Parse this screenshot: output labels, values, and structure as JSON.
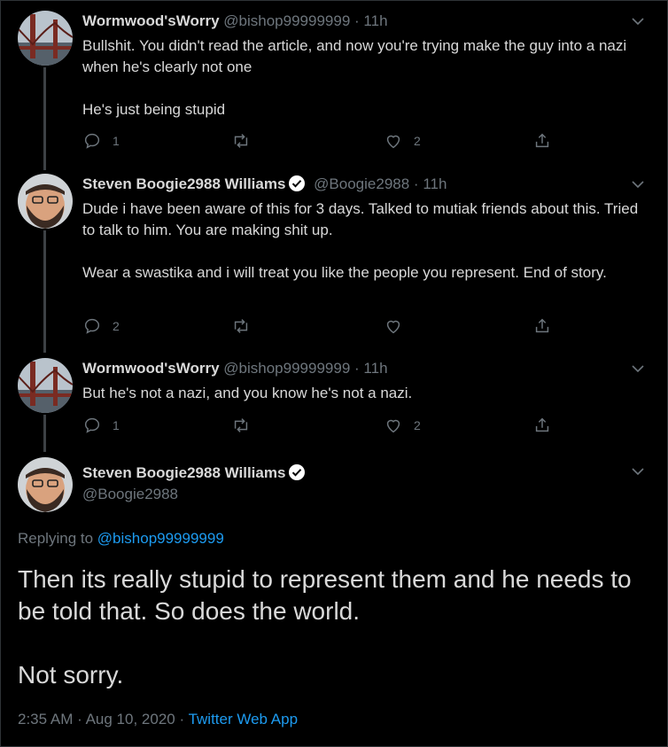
{
  "thread": [
    {
      "name": "Wormwood'sWorry",
      "handle": "@bishop99999999",
      "time": "11h",
      "text": "Bullshit.  You didn't read the article, and now you're trying make the guy into a nazi when he's clearly not one\n\nHe's just being stupid",
      "reply_count": "1",
      "retweet_count": "",
      "like_count": "2",
      "avatar": "golden-gate-bridge",
      "verified": false
    },
    {
      "name": "Steven Boogie2988 Williams",
      "handle": "@Boogie2988",
      "time": "11h",
      "text": "Dude i have been aware of this for 3 days.  Talked to mutiak friends about this. Tried to talk to him.  You are making shit up.\n\nWear a swastika and i will treat you like the people you represent.  End of story.",
      "reply_count": "2",
      "retweet_count": "",
      "like_count": "",
      "avatar": "bearded-man",
      "verified": true
    },
    {
      "name": "Wormwood'sWorry",
      "handle": "@bishop99999999",
      "time": "11h",
      "text": "But he's not a nazi, and you know he's not a nazi.",
      "reply_count": "1",
      "retweet_count": "",
      "like_count": "2",
      "avatar": "golden-gate-bridge",
      "verified": false
    }
  ],
  "main": {
    "name": "Steven Boogie2988 Williams",
    "handle": "@Boogie2988",
    "replying_prefix": "Replying to",
    "replying_to": "@bishop99999999",
    "text": "Then its really stupid to represent them and he needs to be told that.  So does the world.\n\nNot sorry.",
    "time": "2:35 AM",
    "date": "Aug 10, 2020",
    "source": "Twitter Web App",
    "verified": true
  },
  "separator": "·",
  "colors": {
    "background": "#000000",
    "text": "#d9d9d9",
    "secondary": "#6e767d",
    "link": "#1d9bf0",
    "verified_badge": "#ffffff"
  }
}
